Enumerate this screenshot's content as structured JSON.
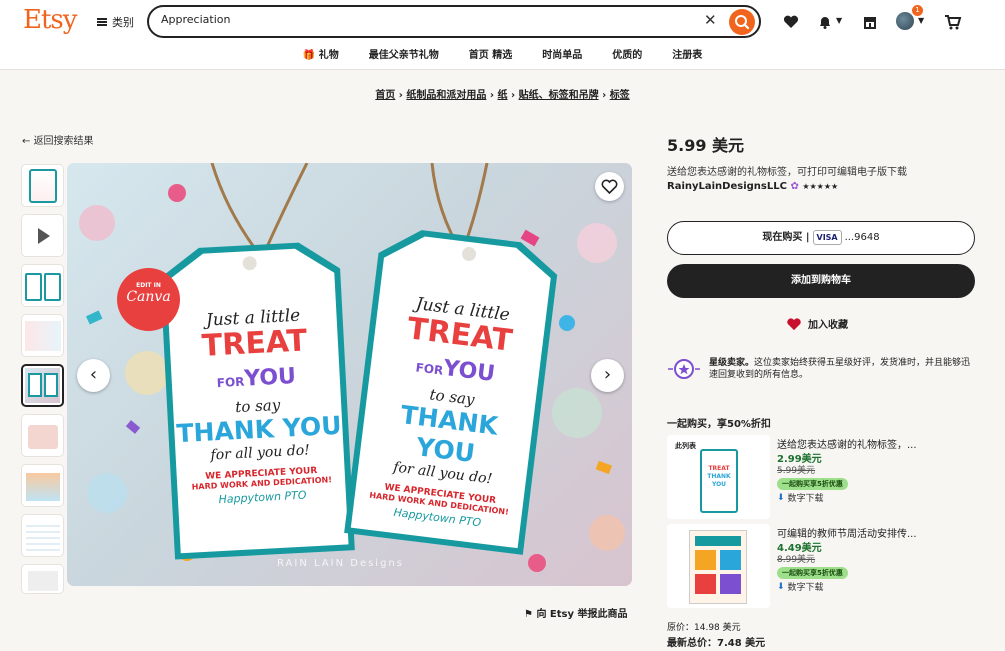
{
  "header": {
    "logo": "Etsy",
    "categories_label": "类别",
    "search_value": "Appreciation",
    "cart_badge": "1",
    "nav": [
      "礼物",
      "最佳父亲节礼物",
      "首页 精选",
      "时尚单品",
      "优质的",
      "注册表"
    ]
  },
  "breadcrumb": {
    "items": [
      "首页",
      "纸制品和派对用品",
      "纸",
      "贴纸、标签和吊牌",
      "标签"
    ],
    "sep": "›"
  },
  "back_label": "返回搜索结果",
  "image": {
    "canva_top": "EDIT IN",
    "canva_bottom": "Canva",
    "tag_line1": "Just a little",
    "tag_line2": "TREAT",
    "tag_line3": "FOR",
    "tag_line4": "YOU",
    "tag_line5": "to say",
    "tag_line6": "THANK YOU",
    "tag_line7": "for all you do!",
    "tag_line8": "WE APPRECIATE YOUR",
    "tag_line9": "HARD WORK AND DEDICATION!",
    "tag_line10": "Happytown PTO",
    "watermark": "RAIN LAIN Designs"
  },
  "report_label": "向 Etsy 举报此商品",
  "product": {
    "price": "5.99 美元",
    "description": "送给您表达感谢的礼物标签，可打印可编辑电子版下载",
    "shop": "RainyLainDesignsLLC",
    "stars": "★★★★★",
    "buy_now": "现在购买 |",
    "visa": "VISA",
    "card": "...9648",
    "add_cart": "添加到购物车",
    "add_fav": "加入收藏",
    "star_seller_title": "星级卖家。",
    "star_seller_text": "这位卖家始终获得五星级好评，发货准时，并且能够迅速回复收到的所有信息。"
  },
  "bundle": {
    "title": "一起购买，享50%折扣",
    "items": [
      {
        "label": "此列表",
        "title": "送给您表达感谢的礼物标签，...",
        "price": "2.99美元",
        "old": "5.99美元",
        "badge": "一起购买享5折优惠",
        "dl": "数字下载"
      },
      {
        "label": "",
        "title": "可编辑的教师节周活动安排传...",
        "price": "4.49美元",
        "old": "8.99美元",
        "badge": "一起购买享5折优惠",
        "dl": "数字下载"
      }
    ],
    "orig": "原价：14.98 美元",
    "final": "最新总价：7.48 美元"
  }
}
